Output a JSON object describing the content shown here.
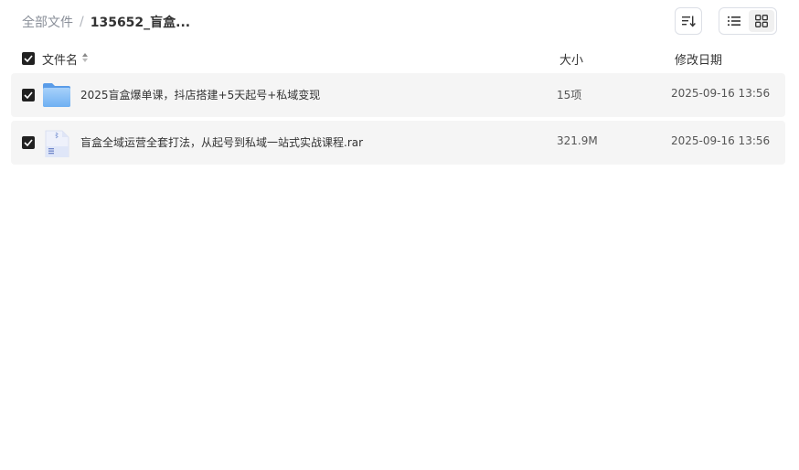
{
  "breadcrumb": {
    "root": "全部文件",
    "separator": "/",
    "current": "135652_盲盒..."
  },
  "toolbar": {
    "sort_icon": "sort-list-icon",
    "list_view_icon": "list-view-icon",
    "grid_view_icon": "grid-view-icon",
    "active_view": "list"
  },
  "table": {
    "columns": {
      "name": "文件名",
      "size": "大小",
      "date": "修改日期"
    },
    "rows": [
      {
        "type": "folder",
        "icon": "folder-icon",
        "checked": true,
        "name": "2025盲盒爆单课，抖店搭建+5天起号+私域变现",
        "size": "15项",
        "date": "2025-09-16 13:56"
      },
      {
        "type": "archive",
        "icon": "archive-file-icon",
        "checked": true,
        "name": "盲盒全域运营全套打法，从起号到私域一站式实战课程.rar",
        "size": "321.9M",
        "date": "2025-09-16 13:56"
      }
    ]
  },
  "colors": {
    "checkbox": "#212121",
    "row_background": "#f5f5f5",
    "folder": "#7ab8f5"
  }
}
